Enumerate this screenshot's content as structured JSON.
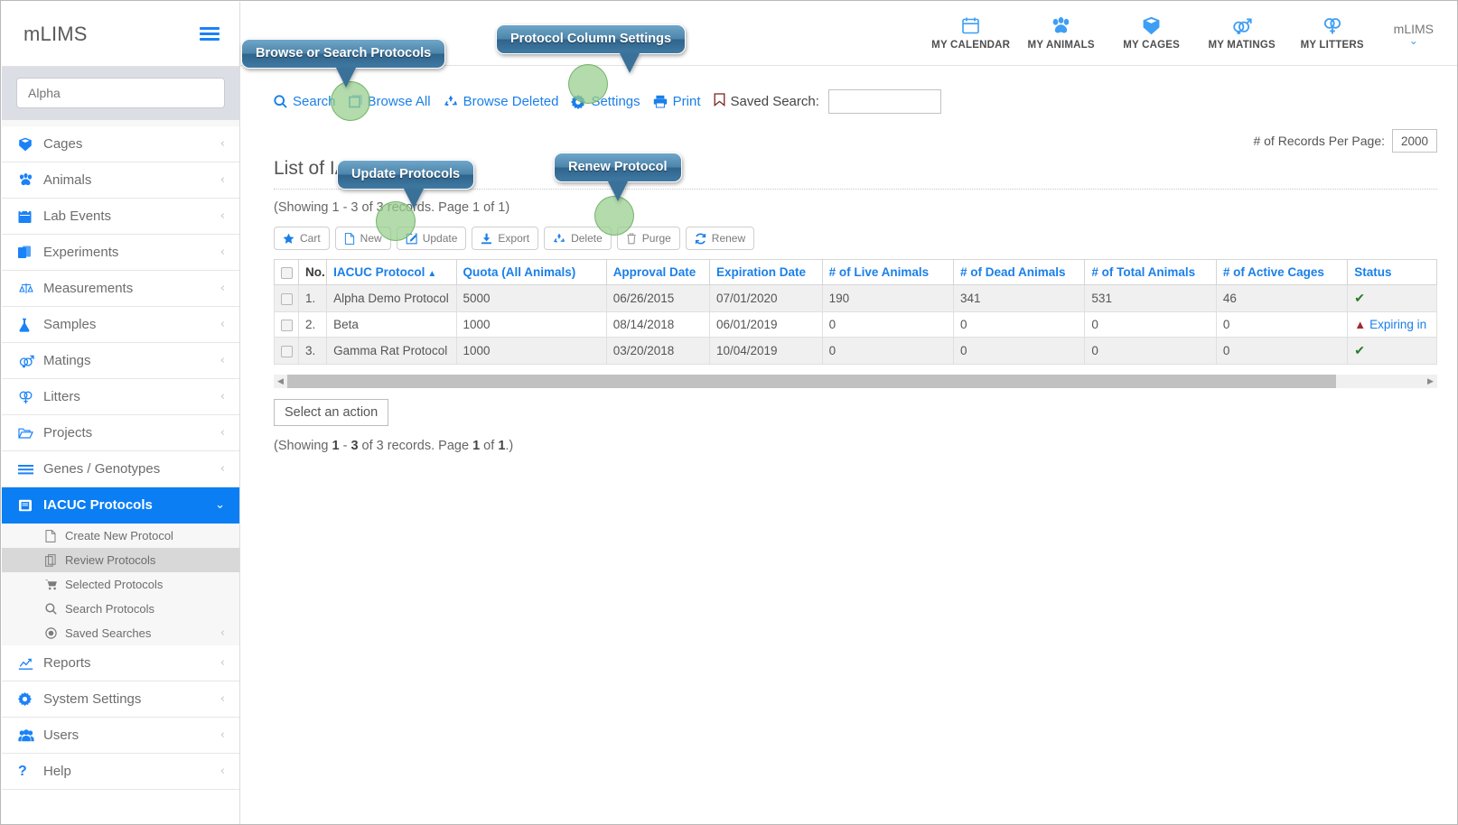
{
  "sidebar": {
    "brand": "mLIMS",
    "search_placeholder": "Alpha",
    "items": [
      {
        "label": "Cages",
        "icon": "cube-icon"
      },
      {
        "label": "Animals",
        "icon": "paw-icon"
      },
      {
        "label": "Lab Events",
        "icon": "calendar-icon"
      },
      {
        "label": "Experiments",
        "icon": "documents-icon"
      },
      {
        "label": "Measurements",
        "icon": "scale-icon"
      },
      {
        "label": "Samples",
        "icon": "flask-icon"
      },
      {
        "label": "Matings",
        "icon": "mating-icon"
      },
      {
        "label": "Litters",
        "icon": "litters-icon"
      },
      {
        "label": "Projects",
        "icon": "folder-open-icon"
      },
      {
        "label": "Genes / Genotypes",
        "icon": "lines-icon"
      },
      {
        "label": "IACUC Protocols",
        "icon": "book-icon",
        "active": true
      },
      {
        "label": "Reports",
        "icon": "chart-line-icon"
      },
      {
        "label": "System Settings",
        "icon": "gear-icon"
      },
      {
        "label": "Users",
        "icon": "users-icon"
      },
      {
        "label": "Help",
        "icon": "question-icon"
      }
    ],
    "subitems": [
      {
        "label": "Create New Protocol",
        "icon": "file-icon"
      },
      {
        "label": "Review Protocols",
        "icon": "copy-icon",
        "selected": true
      },
      {
        "label": "Selected Protocols",
        "icon": "cart-icon"
      },
      {
        "label": "Search Protocols",
        "icon": "search-icon"
      },
      {
        "label": "Saved Searches",
        "icon": "target-icon",
        "chevron": true
      }
    ]
  },
  "topbar": {
    "items": [
      {
        "label": "MY CALENDAR",
        "icon": "calendar-icon"
      },
      {
        "label": "MY ANIMALS",
        "icon": "paw-icon"
      },
      {
        "label": "MY CAGES",
        "icon": "cube-icon"
      },
      {
        "label": "MY MATINGS",
        "icon": "mating-icon"
      },
      {
        "label": "MY LITTERS",
        "icon": "litters-icon"
      }
    ],
    "user": "mLIMS"
  },
  "actions": [
    {
      "label": "Search",
      "icon": "search-icon"
    },
    {
      "label": "Browse All",
      "icon": "browse-icon"
    },
    {
      "label": "Browse Deleted",
      "icon": "recycle-icon"
    },
    {
      "label": "Settings",
      "icon": "gear-icon"
    },
    {
      "label": "Print",
      "icon": "printer-icon"
    }
  ],
  "saved_search": {
    "label": "Saved Search:",
    "icon": "bookmark-icon",
    "value": ""
  },
  "records_per_page": {
    "label": "# of Records Per Page:",
    "value": "2000"
  },
  "page": {
    "title": "List of IACUC Protocols",
    "showing_top": "(Showing 1 - 3 of 3 records. Page 1 of 1)",
    "select_action": "Select an action",
    "footer_showing_parts": [
      "(Showing ",
      "1",
      " - ",
      "3",
      " of 3 records. Page ",
      "1",
      " of ",
      "1",
      ".)"
    ]
  },
  "toolbar_buttons": [
    {
      "label": "Cart",
      "icon": "star-icon"
    },
    {
      "label": "New",
      "icon": "file-icon"
    },
    {
      "label": "Update",
      "icon": "pencil-square-icon"
    },
    {
      "label": "Export",
      "icon": "download-icon"
    },
    {
      "label": "Delete",
      "icon": "recycle-icon"
    },
    {
      "label": "Purge",
      "icon": "trash-icon"
    },
    {
      "label": "Renew",
      "icon": "refresh-icon"
    }
  ],
  "table": {
    "columns": [
      "No.",
      "IACUC Protocol",
      "Quota (All Animals)",
      "Approval Date",
      "Expiration Date",
      "# of Live Animals",
      "# of Dead Animals",
      "# of Total Animals",
      "# of Active Cages",
      "Status"
    ],
    "sorted_column": "IACUC Protocol",
    "sort_direction": "asc",
    "rows": [
      {
        "no": "1.",
        "protocol": "Alpha Demo Protocol",
        "quota": "5000",
        "approval": "06/26/2015",
        "expiration": "07/01/2020",
        "live": "190",
        "dead": "341",
        "total": "531",
        "cages": "46",
        "status_icon": "check-icon",
        "status_text": ""
      },
      {
        "no": "2.",
        "protocol": "Beta",
        "quota": "1000",
        "approval": "08/14/2018",
        "expiration": "06/01/2019",
        "live": "0",
        "dead": "0",
        "total": "0",
        "cages": "0",
        "status_icon": "warning-icon",
        "status_text": "Expiring in"
      },
      {
        "no": "3.",
        "protocol": "Gamma Rat Protocol",
        "quota": "1000",
        "approval": "03/20/2018",
        "expiration": "10/04/2019",
        "live": "0",
        "dead": "0",
        "total": "0",
        "cages": "0",
        "status_icon": "check-icon",
        "status_text": ""
      }
    ]
  },
  "callouts": [
    {
      "text": "Browse or Search Protocols"
    },
    {
      "text": "Protocol Column Settings"
    },
    {
      "text": "Update Protocols"
    },
    {
      "text": "Renew Protocol"
    }
  ],
  "colors": {
    "accent": "#1a7fe8",
    "sidebar_active": "#0b7ef4",
    "callout": "#3f7aa3",
    "highlight_spot": "#96cd8c",
    "status_ok": "#2a7a2a",
    "status_warn": "#9f2b2b"
  }
}
